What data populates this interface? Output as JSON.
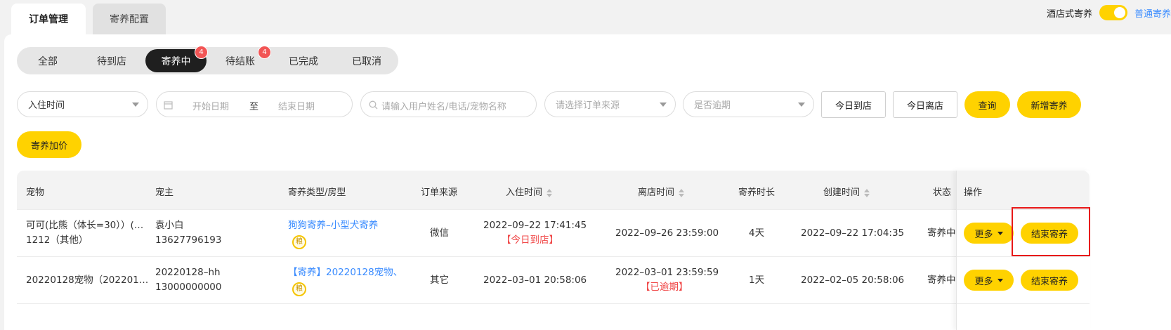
{
  "tabs": {
    "active": "订单管理",
    "inactive": "寄养配置"
  },
  "toggle": {
    "label": "酒店式寄养",
    "alt": "普通寄养"
  },
  "status_tabs": [
    {
      "label": "全部"
    },
    {
      "label": "待到店"
    },
    {
      "label": "寄养中",
      "badge": "4"
    },
    {
      "label": "待结账",
      "badge": "4"
    },
    {
      "label": "已完成"
    },
    {
      "label": "已取消"
    }
  ],
  "filters": {
    "time_type": "入住时间",
    "start_placeholder": "开始日期",
    "range_sep": "至",
    "end_placeholder": "结束日期",
    "search_placeholder": "请输入用户姓名/电话/宠物名称",
    "source_placeholder": "请选择订单来源",
    "overdue_placeholder": "是否逾期",
    "today_arrive": "今日到店",
    "today_leave": "今日离店",
    "query": "查询",
    "add": "新增寄养",
    "price": "寄养加价"
  },
  "columns": [
    "宠物",
    "宠主",
    "寄养类型/房型",
    "订单来源",
    "入住时间",
    "离店时间",
    "寄养时长",
    "创建时间",
    "状态",
    "操作"
  ],
  "rows": [
    {
      "pet": "可可(比熊（体长=30））(…",
      "pet2": "1212（其他）",
      "owner": "袁小白",
      "phone": "13627796193",
      "type": "狗狗寄养–小型犬寄养",
      "grain": "粮",
      "source": "微信",
      "checkin": "2022–09–22 17:41:45",
      "checkin_note": "【今日到店】",
      "checkout": "2022–09–26 23:59:00",
      "checkout_note": "",
      "duration": "4天",
      "created": "2022–09–22 17:04:35",
      "status": "寄养中",
      "more": "更多",
      "end": "结束寄养"
    },
    {
      "pet": "20220128宠物（202201…",
      "pet2": "",
      "owner": "20220128–hh",
      "phone": "13000000000",
      "type": "【寄养】20220128宠物、",
      "grain": "粮",
      "source": "其它",
      "checkin": "2022–03–01 20:58:06",
      "checkin_note": "",
      "checkout": "2022–03–01 23:59:59",
      "checkout_note": "【已逾期】",
      "duration": "1天",
      "created": "2022–02–05 20:58:06",
      "status": "寄养中",
      "more": "更多",
      "end": "结束寄养"
    }
  ]
}
